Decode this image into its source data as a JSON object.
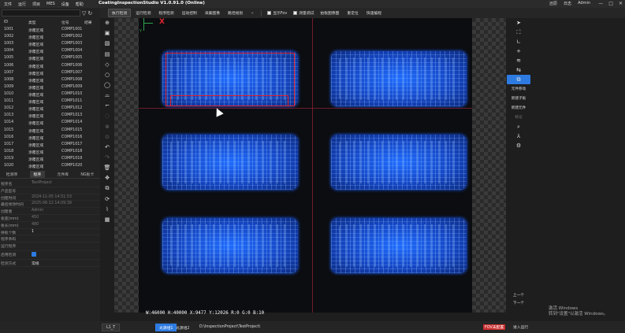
{
  "menu": [
    "文件",
    "运行",
    "项目",
    "MES",
    "设备",
    "帮助"
  ],
  "app_title": "CoatingInspectionStudio V1.0.91.0 (Online)",
  "user_menu": [
    "还原",
    "日志",
    "Admin"
  ],
  "window_controls": [
    "—",
    "□",
    "✕"
  ],
  "toolbar": {
    "buttons": [
      "执行检测",
      "运行检测",
      "程序检测",
      "运动控制",
      "采集图像",
      "路径规划"
    ],
    "checks": [
      {
        "label": "显示Fov",
        "checked": false
      },
      {
        "label": "测量调试",
        "checked": false
      }
    ],
    "buttons2": [
      "拍板图像图",
      "重定位",
      "快速编程"
    ]
  },
  "components": {
    "headers": {
      "id": "ID",
      "type": "类型",
      "code": "位号",
      "result": "结果"
    },
    "rows": [
      {
        "id": "1001",
        "type": "涂覆区域",
        "code": "COMP1001"
      },
      {
        "id": "1002",
        "type": "涂覆区域",
        "code": "COMP1002"
      },
      {
        "id": "1003",
        "type": "涂覆区域",
        "code": "COMP1003"
      },
      {
        "id": "1004",
        "type": "涂覆区域",
        "code": "COMP1004"
      },
      {
        "id": "1005",
        "type": "涂覆区域",
        "code": "COMP1005"
      },
      {
        "id": "1006",
        "type": "涂覆区域",
        "code": "COMP1006"
      },
      {
        "id": "1007",
        "type": "涂覆区域",
        "code": "COMP1007"
      },
      {
        "id": "1008",
        "type": "涂覆区域",
        "code": "COMP1008"
      },
      {
        "id": "1009",
        "type": "涂覆区域",
        "code": "COMP1009"
      },
      {
        "id": "1010",
        "type": "涂覆区域",
        "code": "COMP1010"
      },
      {
        "id": "1011",
        "type": "涂覆区域",
        "code": "COMP1011"
      },
      {
        "id": "1012",
        "type": "涂覆区域",
        "code": "COMP1012"
      },
      {
        "id": "1013",
        "type": "涂覆区域",
        "code": "COMP1013"
      },
      {
        "id": "1014",
        "type": "涂覆区域",
        "code": "COMP1014"
      },
      {
        "id": "1015",
        "type": "涂覆区域",
        "code": "COMP1015"
      },
      {
        "id": "1016",
        "type": "涂覆区域",
        "code": "COMP1016"
      },
      {
        "id": "1017",
        "type": "涂覆区域",
        "code": "COMP1017"
      },
      {
        "id": "1018",
        "type": "涂覆区域",
        "code": "COMP1018"
      },
      {
        "id": "1019",
        "type": "涂覆区域",
        "code": "COMP1019"
      },
      {
        "id": "1020",
        "type": "涂覆区域",
        "code": "COMP1020"
      }
    ]
  },
  "panel_tabs": [
    "检测项",
    "程序",
    "元件库",
    "NG板卡"
  ],
  "properties": [
    {
      "key": "程序名",
      "value": "TestProject"
    },
    {
      "key": "产品型号",
      "value": ""
    },
    {
      "key": "创建时间",
      "value": "2024-11-05 14:51:53"
    },
    {
      "key": "最后修改时间",
      "value": "2025-06-12 14:09:39"
    },
    {
      "key": "创建者",
      "value": "Admin"
    },
    {
      "key": "板宽(mm)",
      "value": "450"
    },
    {
      "key": "板长(mm)",
      "value": "480"
    },
    {
      "key": "拼板个数",
      "value": "1"
    },
    {
      "key": "程序条码",
      "value": ""
    }
  ],
  "props_section": "运行程序",
  "enable_detection": {
    "label": "启用检测",
    "checked": true
  },
  "detect_mode": {
    "label": "检测方式",
    "value": "常规"
  },
  "right_labels": [
    "元件移动",
    "新建子板",
    "新建元件",
    "标记"
  ],
  "nav": {
    "prev": "上一个",
    "next": "下一个"
  },
  "coords_text": "W:46000 H:40000 X:9477 Y:12026 R:0 G:0 B:10",
  "activate_text": [
    "激活 Windows",
    "转到\"设置\"以激活 Windows。"
  ],
  "status": {
    "layer": "L1_T",
    "light1": "光源组1",
    "light2": "光源组2",
    "path": "D:\\InspectionProject\\TestProject\\",
    "fov": "FOV未配置",
    "enter": "进入运行"
  },
  "colors": {
    "accent": "#2d7be0",
    "board": "#1f5cf0",
    "mark": "#e0242f"
  }
}
